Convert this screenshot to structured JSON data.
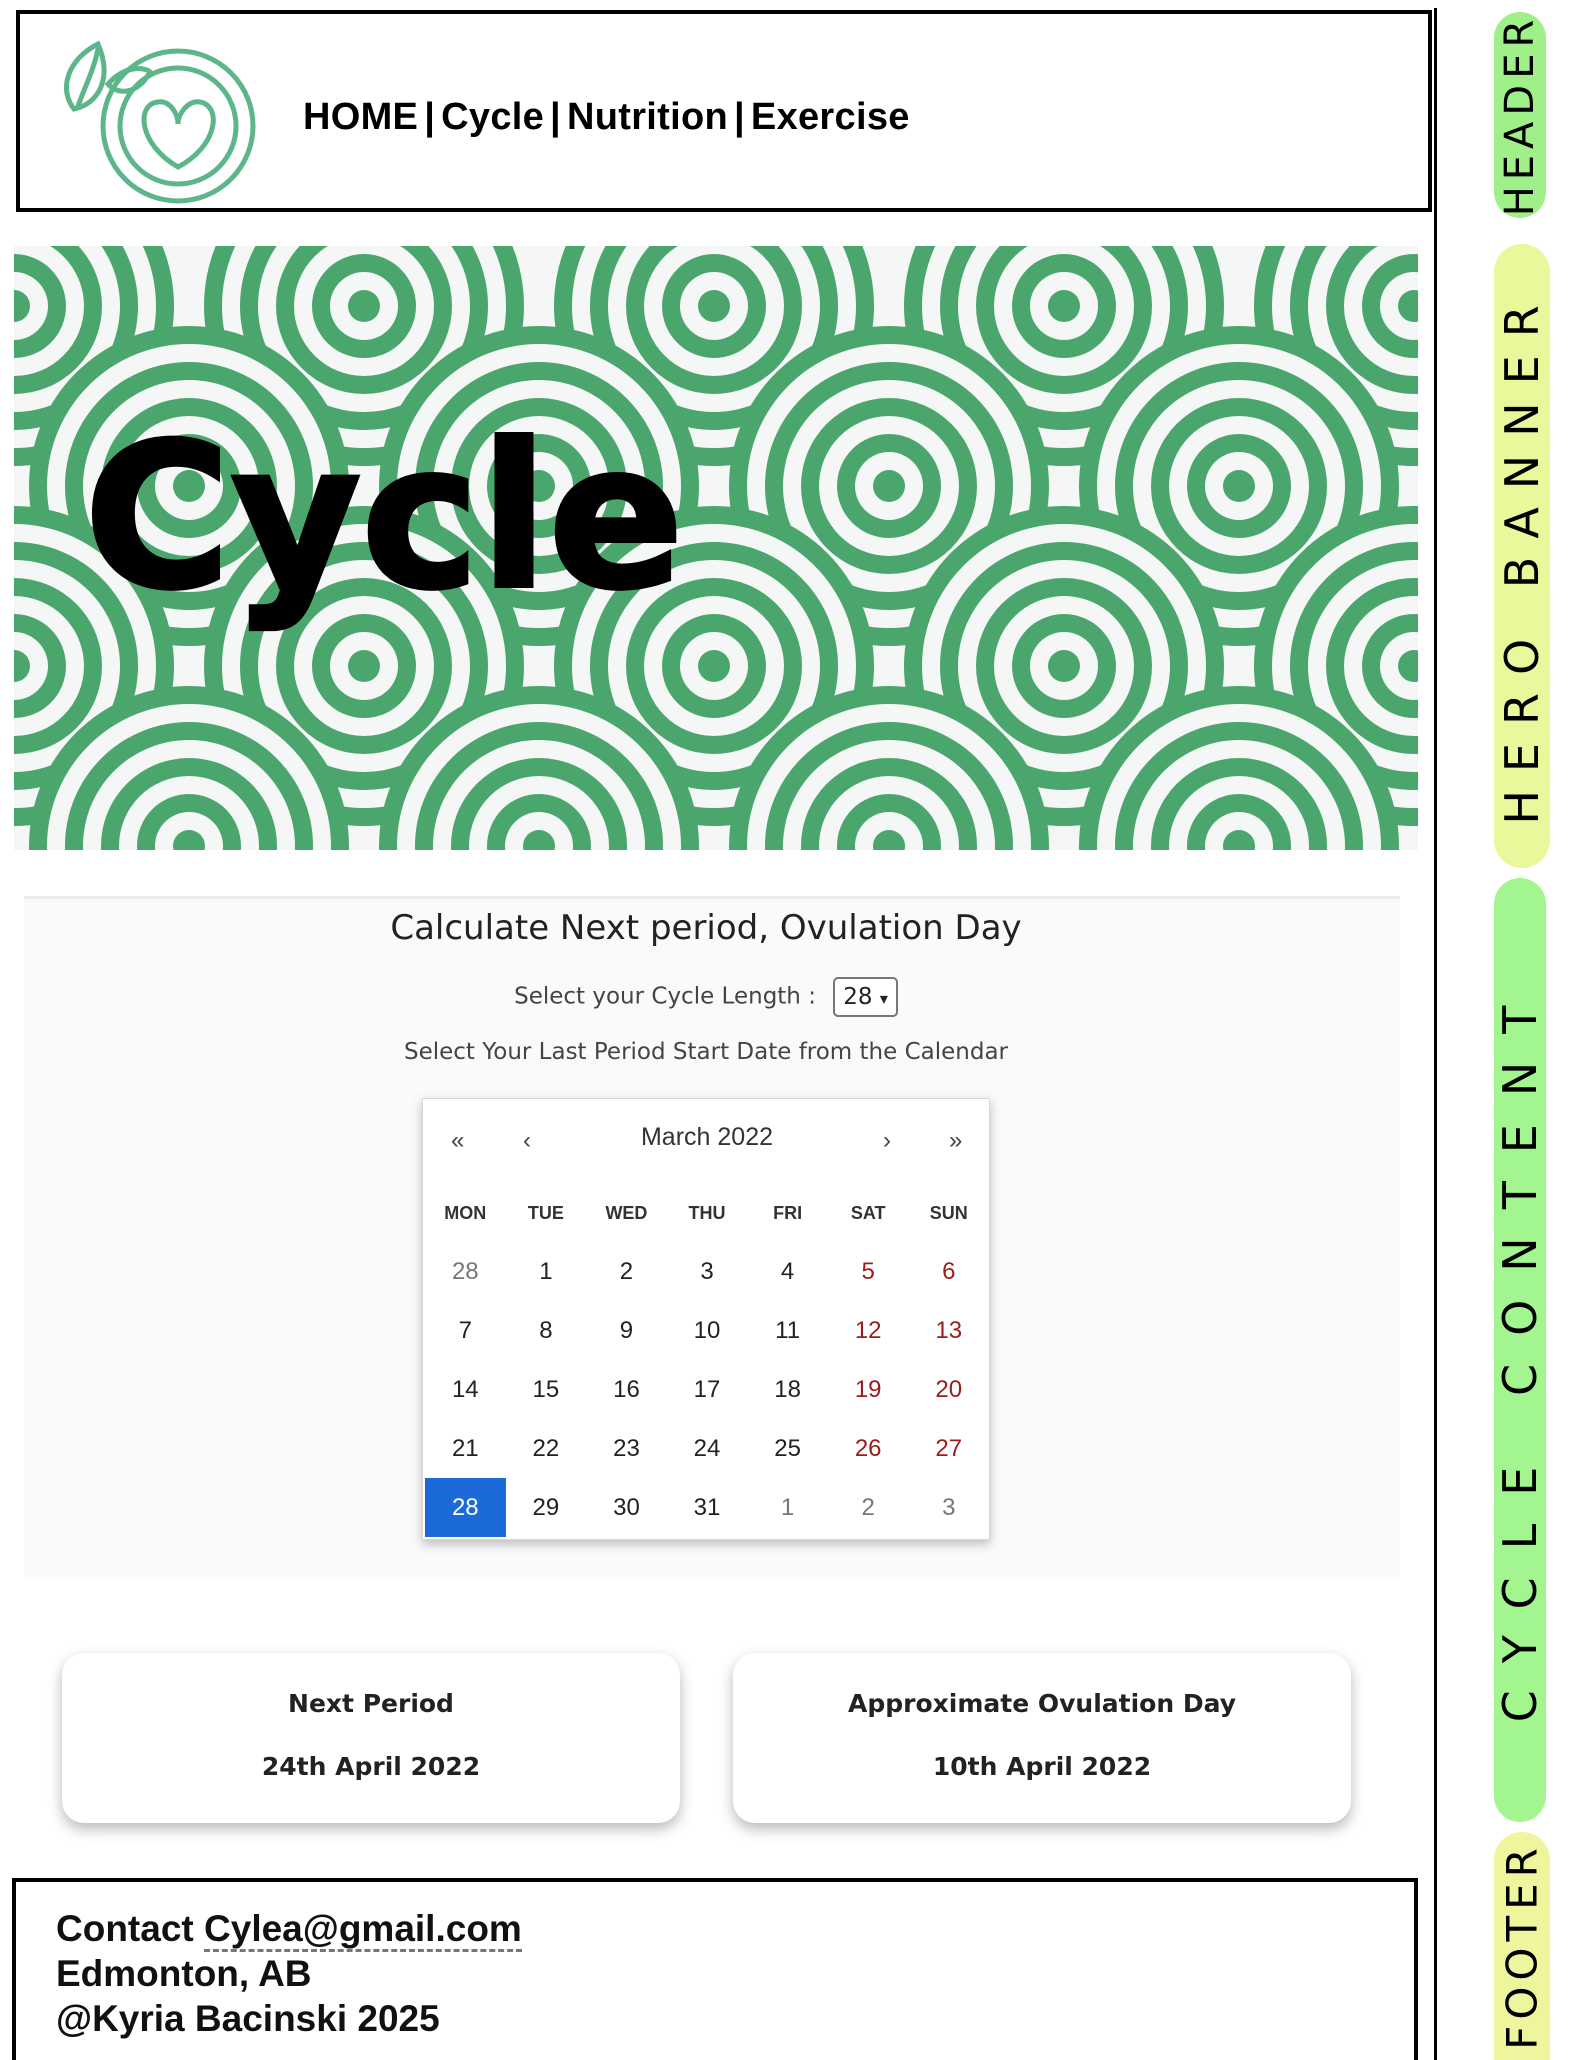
{
  "header": {
    "nav": [
      "HOME",
      "Cycle",
      "Nutrition",
      "Exercise"
    ]
  },
  "hero": {
    "title": "Cycle"
  },
  "calculator": {
    "title": "Calculate Next period, Ovulation Day",
    "cycle_length_label": "Select your Cycle Length :",
    "cycle_length_value": "28",
    "start_date_label": "Select Your Last Period Start Date from the Calendar",
    "calendar": {
      "nav_first": "«",
      "nav_prev": "‹",
      "month": "March 2022",
      "nav_next": "›",
      "nav_last": "»",
      "weekdays": [
        "MON",
        "TUE",
        "WED",
        "THU",
        "FRI",
        "SAT",
        "SUN"
      ],
      "weeks": [
        [
          "28",
          "1",
          "2",
          "3",
          "4",
          "5",
          "6"
        ],
        [
          "7",
          "8",
          "9",
          "10",
          "11",
          "12",
          "13"
        ],
        [
          "14",
          "15",
          "16",
          "17",
          "18",
          "19",
          "20"
        ],
        [
          "21",
          "22",
          "23",
          "24",
          "25",
          "26",
          "27"
        ],
        [
          "28",
          "29",
          "30",
          "31",
          "1",
          "2",
          "3"
        ]
      ],
      "selected": "28"
    }
  },
  "results": {
    "next_period_label": "Next Period",
    "next_period_value": "24th April 2022",
    "ovulation_label": "Approximate Ovulation Day",
    "ovulation_value": "10th April 2022"
  },
  "footer": {
    "contact_label": "Contact",
    "email": "Cylea@gmail.com",
    "location": "Edmonton, AB",
    "credit": "@Kyria Bacinski 2025"
  },
  "annotations": {
    "header": "HEADER",
    "hero": "HERO BANNER",
    "content": "CYCLE CONTENT",
    "footer": "FOOTER"
  },
  "colors": {
    "brand_green": "#4aa66d",
    "selected_day": "#1c6ad7",
    "weekend_text": "#9b1c1c",
    "pill_header": "#a0f08a",
    "pill_hero": "#eaf79a",
    "pill_content": "#a3f58f",
    "pill_footer": "#eef59c"
  }
}
